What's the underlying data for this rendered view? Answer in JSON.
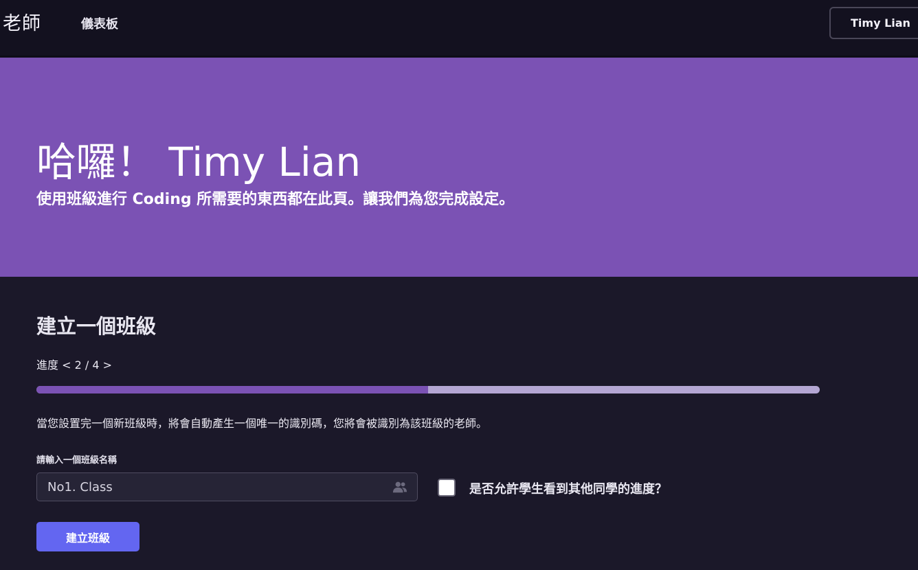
{
  "header": {
    "brand": "老師",
    "nav_dashboard": "儀表板",
    "user_name": "Timy Lian"
  },
  "hero": {
    "title": "哈囉！ Timy Lian",
    "subtitle": "使用班級進行 Coding 所需要的東西都在此頁。讓我們為您完成設定。"
  },
  "main": {
    "section_title": "建立一個班級",
    "progress_label": "進度 < 2 / 4 >",
    "progress_fraction": 0.5,
    "info_text": "當您設置完一個新班級時，將會自動產生一個唯一的識別碼，您將會被識別為該班級的老師。",
    "class_name_label": "請輸入一個班級名稱",
    "class_name_value": "No1. Class",
    "checkbox_label": "是否允許學生看到其他同學的進度？",
    "checkbox_checked": false,
    "create_button": "建立班級"
  },
  "colors": {
    "topbar_bg": "#13111f",
    "hero_bg": "#7b52b4",
    "page_bg": "#1b1829",
    "progress_fill": "#7b52b4",
    "progress_track": "#b4a6d3",
    "primary_button": "#6366f1"
  },
  "icons": {
    "input_icon": "users-icon"
  }
}
